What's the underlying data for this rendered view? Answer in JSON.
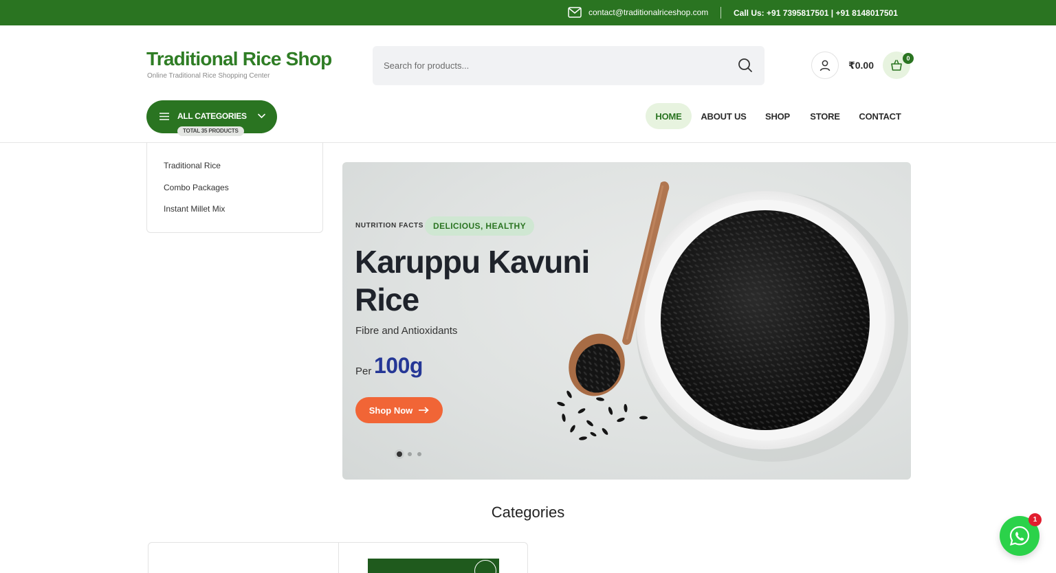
{
  "topbar": {
    "email": "contact@traditionalriceshop.com",
    "phone": "Call Us: +91 7395817501 | +91 8148017501"
  },
  "header": {
    "logo_title": "Traditional Rice Shop",
    "logo_subtitle": "Online Traditional Rice Shopping Center",
    "search_placeholder": "Search for products...",
    "cart_total": "₹0.00",
    "cart_count": "0"
  },
  "nav": {
    "all_categories": "ALL CATEGORIES",
    "total_products": "TOTAL 35 PRODUCTS",
    "items": [
      "HOME",
      "ABOUT US",
      "SHOP",
      "STORE",
      "CONTACT"
    ],
    "active": "HOME"
  },
  "sidebar": {
    "items": [
      "Traditional Rice",
      "Combo Packages",
      "Instant Millet Mix"
    ]
  },
  "hero": {
    "kicker": "NUTRITION FACTS",
    "tag": "DELICIOUS, HEALTHY",
    "title": "Karuppu Kavuni Rice",
    "subtitle": "Fibre and Antioxidants",
    "per": "Per",
    "weight": "100g",
    "button": "Shop Now",
    "slide_count": 3,
    "active_slide": 1
  },
  "sections": {
    "categories_heading": "Categories"
  },
  "chat": {
    "badge": "1"
  },
  "colors": {
    "brand_green": "#2a7421",
    "accent_orange": "#f16536",
    "weight_blue": "#253796",
    "chat_green": "#2bd24a",
    "badge_red": "#e11d2e"
  }
}
